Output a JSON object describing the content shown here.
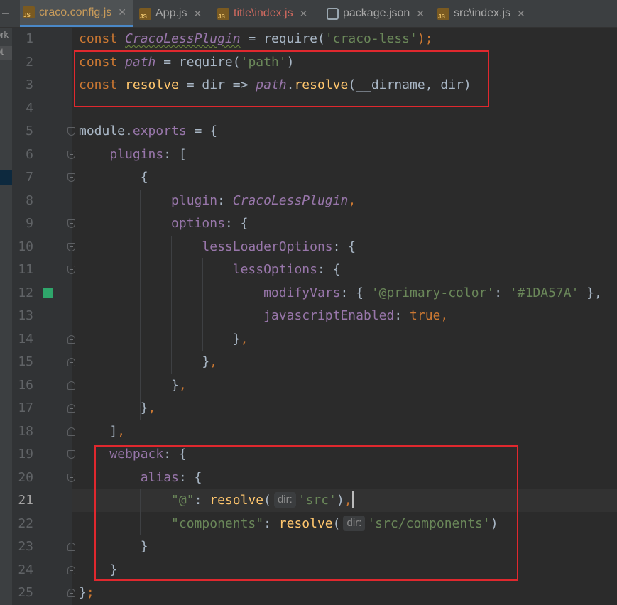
{
  "tabs": [
    {
      "label": "craco.config.js",
      "icon": "js-file-icon",
      "active": true,
      "color": "#c89b5a"
    },
    {
      "label": "App.js",
      "icon": "js-file-icon",
      "active": false,
      "color": "#a8a8a8"
    },
    {
      "label": "title\\index.js",
      "icon": "js-file-icon",
      "active": false,
      "color": "#d16a5f"
    },
    {
      "label": "package.json",
      "icon": "package-json-icon",
      "active": false,
      "color": "#a8a8a8"
    },
    {
      "label": "src\\index.js",
      "icon": "js-file-icon",
      "active": false,
      "color": "#a8a8a8"
    }
  ],
  "left_strip": {
    "fragment_1": "ork",
    "fragment_2": "ot"
  },
  "editor": {
    "current_line": 21,
    "line_numbers": [
      "1",
      "2",
      "3",
      "4",
      "5",
      "6",
      "7",
      "8",
      "9",
      "10",
      "11",
      "12",
      "13",
      "14",
      "15",
      "16",
      "17",
      "18",
      "19",
      "20",
      "21",
      "22",
      "23",
      "24",
      "25"
    ],
    "code": {
      "l1": {
        "kw": "const",
        "name": "CracoLessPlugin",
        "eq": " = ",
        "fn": "require",
        "open": "(",
        "arg": "'craco-less'",
        "close": ");"
      },
      "l2": {
        "kw": "const",
        "name": "path",
        "eq": " = ",
        "fn": "require",
        "open": "(",
        "arg": "'path'",
        "close": ")"
      },
      "l3": {
        "kw": "const",
        "name": "resolve",
        "mid": " = dir => ",
        "obj": "path",
        "dot": ".",
        "fn": "resolve",
        "args": "(__dirname, dir)"
      },
      "l5": {
        "a": "module.",
        "prop": "exports",
        "b": " = {"
      },
      "l6": {
        "prop": "plugins",
        "b": ": ["
      },
      "l7": {
        "b": "{"
      },
      "l8": {
        "prop": "plugin",
        "b": ": ",
        "val": "CracoLessPlugin",
        "c": ","
      },
      "l9": {
        "prop": "options",
        "b": ": {"
      },
      "l10": {
        "prop": "lessLoaderOptions",
        "b": ": {"
      },
      "l11": {
        "prop": "lessOptions",
        "b": ": {"
      },
      "l12": {
        "prop": "modifyVars",
        "b": ": { ",
        "key": "'@primary-color'",
        "colon": ": ",
        "val": "'#1DA57A'",
        "end": " },"
      },
      "l13": {
        "prop": "javascriptEnabled",
        "b": ": ",
        "val": "true",
        "c": ","
      },
      "l14": {
        "b": "}",
        "c": ","
      },
      "l15": {
        "b": "}",
        "c": ","
      },
      "l16": {
        "b": "}",
        "c": ","
      },
      "l17": {
        "b": "}",
        "c": ","
      },
      "l18": {
        "b": "]",
        "c": ","
      },
      "l19": {
        "prop": "webpack",
        "b": ": {"
      },
      "l20": {
        "prop": "alias",
        "b": ": {"
      },
      "l21": {
        "key": "\"@\"",
        "colon": ": ",
        "fn": "resolve",
        "open": "(",
        "hint": "dir:",
        "arg": "'src'",
        "close": ")",
        "c": ","
      },
      "l22": {
        "key": "\"components\"",
        "colon": ": ",
        "fn": "resolve",
        "open": "(",
        "hint": "dir:",
        "arg": "'src/components'",
        "close": ")"
      },
      "l23": {
        "b": "}"
      },
      "l24": {
        "b": "}"
      },
      "l25": {
        "b": "}",
        "c": ";"
      }
    }
  },
  "colors": {
    "highlight_box": "#e0282e",
    "change_marker": "#2fa66b",
    "active_tab_underline": "#4a88c7"
  }
}
